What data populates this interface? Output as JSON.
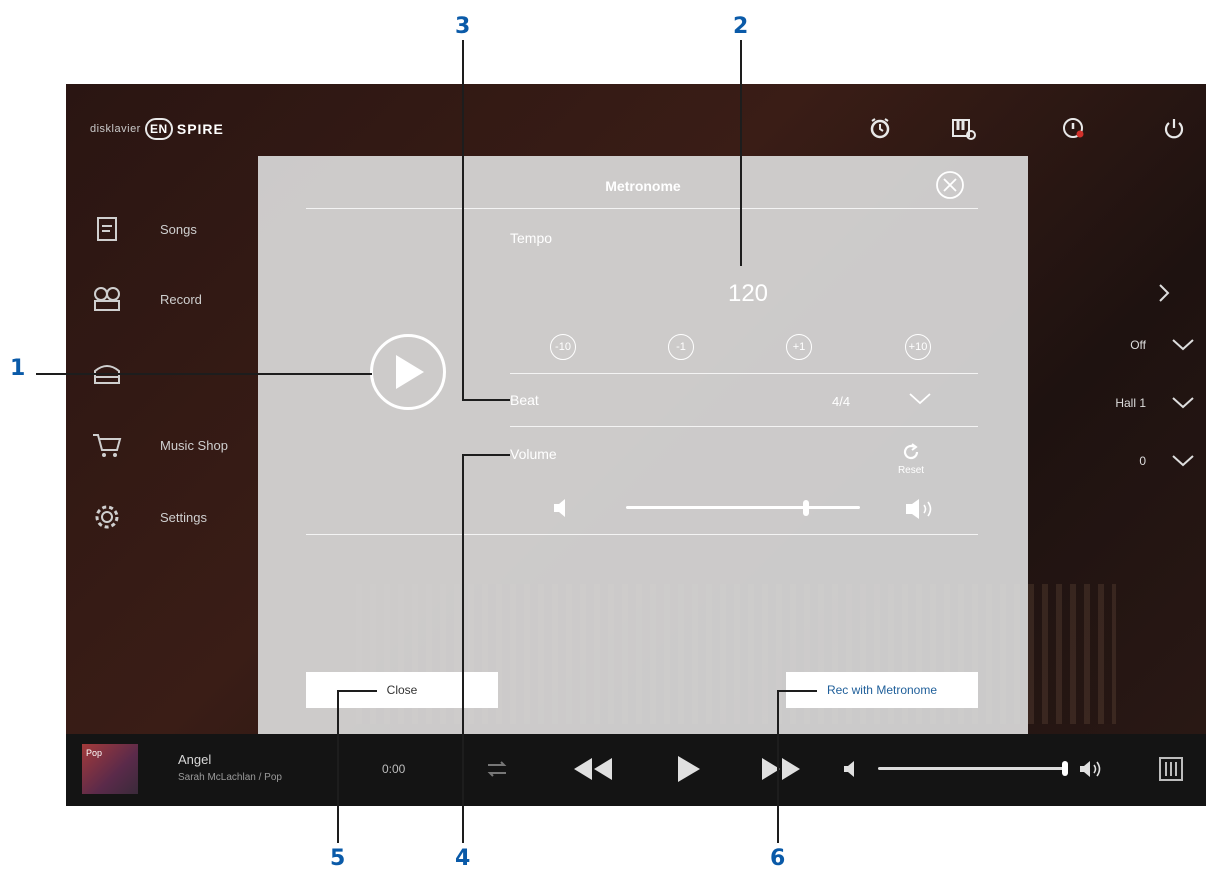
{
  "brand": {
    "prefix": "disklavier",
    "badge": "EN",
    "suffix": "SPIRE"
  },
  "top_icons": [
    "alarm-icon",
    "piano-settings-icon",
    "info-alert-icon",
    "power-icon"
  ],
  "sidebar": {
    "items": [
      {
        "label": "Songs",
        "icon": "songs-icon"
      },
      {
        "label": "Record",
        "icon": "record-icon"
      },
      {
        "label": "",
        "icon": "piano-icon"
      },
      {
        "label": "Music Shop",
        "icon": "cart-icon"
      },
      {
        "label": "Settings",
        "icon": "gear-icon"
      }
    ]
  },
  "right_column": {
    "rows": [
      {
        "value": "Off"
      },
      {
        "value": "Hall 1"
      },
      {
        "value": "0"
      }
    ]
  },
  "now_playing": {
    "thumb_label": "Pop",
    "title": "Angel",
    "subtitle": "Sarah McLachlan / Pop",
    "time": "0:00"
  },
  "dialog": {
    "title": "Metronome",
    "tempo_label": "Tempo",
    "tempo_value": "120",
    "step_buttons": [
      "-10",
      "-1",
      "+1",
      "+10"
    ],
    "beat_label": "Beat",
    "beat_value": "4/4",
    "volume_label": "Volume",
    "reset_label": "Reset",
    "volume_level": 0.77,
    "close_label": "Close",
    "rec_label": "Rec with Metronome"
  },
  "callouts": [
    "1",
    "2",
    "3",
    "4",
    "5",
    "6"
  ],
  "colors": {
    "callout": "#0a5aa8",
    "dialog_bg": "#dadada",
    "rec_text": "#1f5f9a"
  }
}
